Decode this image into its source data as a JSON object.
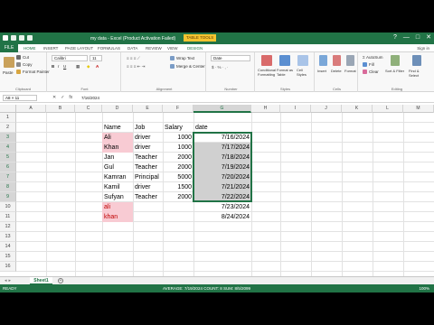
{
  "window": {
    "title": "my data - Excel (Product Activation Failed)",
    "context_tab": "TABLE TOOLS",
    "controls": [
      "?",
      "—",
      "□",
      "✕"
    ]
  },
  "ribbon_tabs": {
    "file": "FILE",
    "items": [
      "HOME",
      "INSERT",
      "PAGE LAYOUT",
      "FORMULAS",
      "DATA",
      "REVIEW",
      "VIEW",
      "DESIGN"
    ],
    "sign_in": "Sign in"
  },
  "ribbon": {
    "clipboard": {
      "paste": "Paste",
      "cut": "Cut",
      "copy": "Copy",
      "format_painter": "Format Painter",
      "label": "Clipboard"
    },
    "font": {
      "name": "Calibri",
      "size": "11",
      "label": "Font"
    },
    "alignment": {
      "wrap": "Wrap Text",
      "merge": "Merge & Center",
      "label": "Alignment"
    },
    "number": {
      "format": "Date",
      "label": "Number"
    },
    "styles": {
      "conditional": "Conditional Formatting",
      "table": "Format as Table",
      "cell": "Cell Styles",
      "label": "Styles"
    },
    "cells": {
      "insert": "Insert",
      "delete": "Delete",
      "format": "Format",
      "label": "Cells"
    },
    "editing": {
      "autosum": "AutoSum",
      "fill": "Fill",
      "clear": "Clear",
      "sort": "Sort & Filter",
      "find": "Find & Select",
      "label": "Editing"
    }
  },
  "formula_bar": {
    "name_box": "A8 × 11",
    "fx": "fx",
    "value": "7/16/2024"
  },
  "columns": [
    "A",
    "B",
    "C",
    "D",
    "E",
    "F",
    "G",
    "H",
    "I",
    "J",
    "K",
    "L",
    "M"
  ],
  "rows": [
    "1",
    "2",
    "3",
    "4",
    "5",
    "6",
    "7",
    "8",
    "9",
    "10",
    "11",
    "12",
    "13",
    "14",
    "15",
    "16"
  ],
  "table": {
    "headers": {
      "name": "Name",
      "job": "Job",
      "salary": "Salary",
      "date": "date"
    },
    "rows": [
      {
        "name": "Ali",
        "job": "driver",
        "salary": "1000",
        "date": "7/16/2024"
      },
      {
        "name": "Khan",
        "job": "driver",
        "salary": "1000",
        "date": "7/17/2024"
      },
      {
        "name": "Jan",
        "job": "Teacher",
        "salary": "2000",
        "date": "7/18/2024"
      },
      {
        "name": "Gul",
        "job": "Teacher",
        "salary": "2000",
        "date": "7/19/2024"
      },
      {
        "name": "Kamran",
        "job": "Principal",
        "salary": "5000",
        "date": "7/20/2024"
      },
      {
        "name": "Kamil",
        "job": "driver",
        "salary": "1500",
        "date": "7/21/2024"
      },
      {
        "name": "Sufyan",
        "job": "Teacher",
        "salary": "2000",
        "date": "7/22/2024"
      },
      {
        "name": "ali",
        "job": "",
        "salary": "",
        "date": "7/23/2024"
      },
      {
        "name": "khan",
        "job": "",
        "salary": "",
        "date": "8/24/2024"
      }
    ]
  },
  "sheet_tabs": {
    "active": "Sheet1",
    "add": "+"
  },
  "status_bar": {
    "ready": "READY",
    "stats": "AVERAGE: 7/19/2024     COUNT: 8     SUM: 8/5/2099",
    "zoom": "100%"
  }
}
